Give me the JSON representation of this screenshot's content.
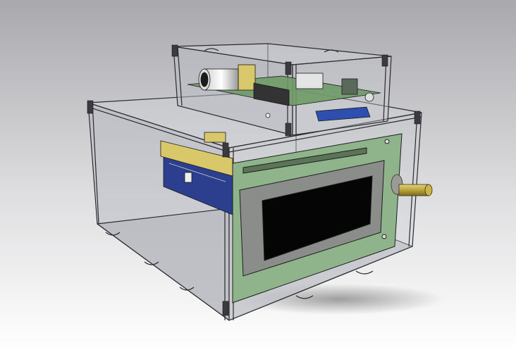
{
  "scene": {
    "subject": "cad-render-enclosure",
    "colors": {
      "background_top": "#a9a9ad",
      "background_bottom": "#ffffff",
      "acrylic": "#c4c6cc",
      "edge": "#2a2a30",
      "pcb_green": "#8fb38a",
      "lcd_frame": "#8a8d8a",
      "lcd_screen": "#050505",
      "header_yellow": "#d9c86a",
      "knob_brass": "#b9a43c",
      "sd_blue": "#2f4fb0",
      "camera_lens": "#e8e8e8"
    }
  }
}
